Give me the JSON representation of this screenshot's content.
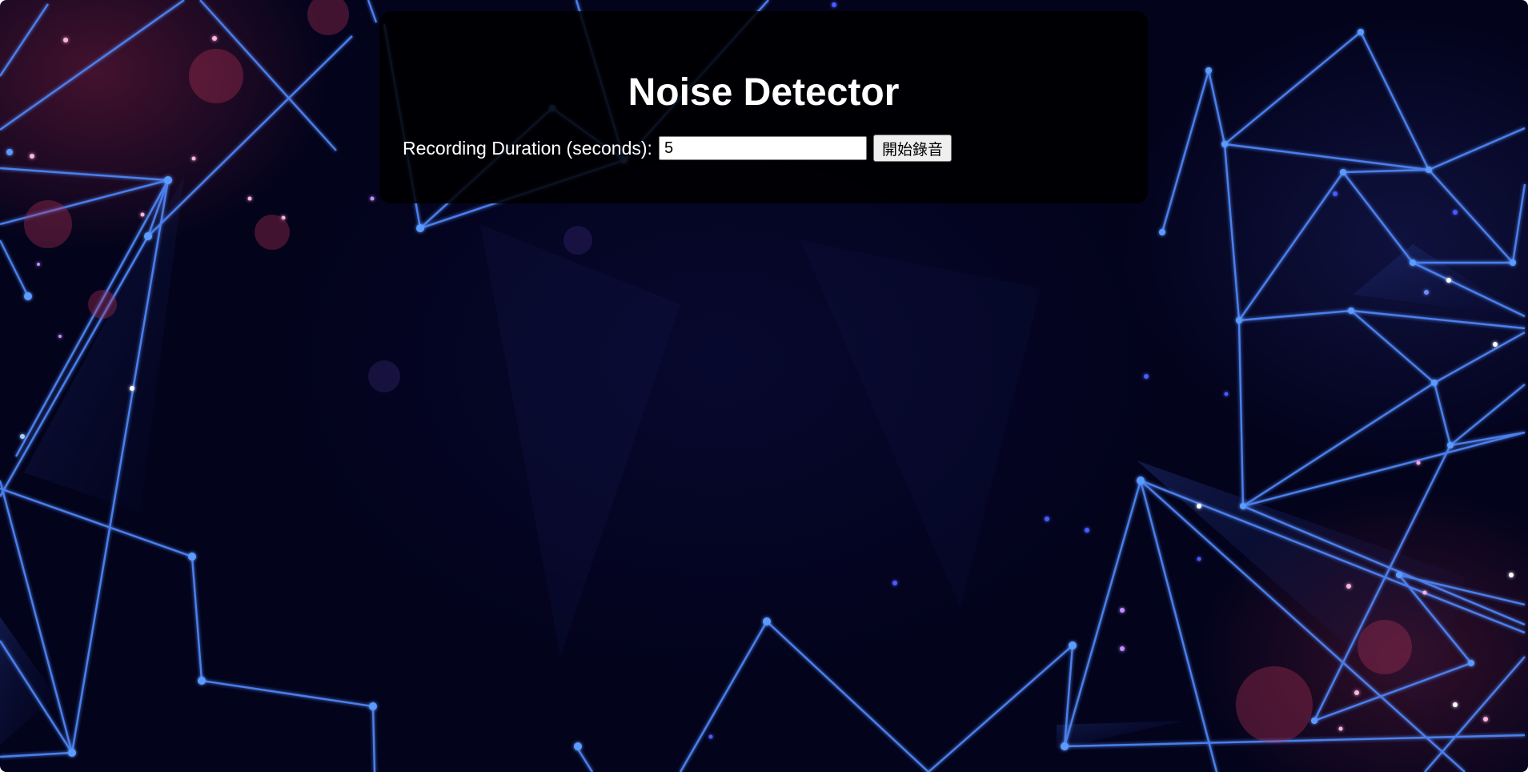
{
  "page": {
    "title": "Noise Detector"
  },
  "controls": {
    "duration_label": "Recording Duration (seconds):",
    "duration_value": "5",
    "start_button_label": "開始錄音"
  },
  "theme": {
    "background": "#03031c",
    "panel_background": "#000000",
    "line_color": "#4f86f7",
    "text_color": "#ffffff"
  }
}
